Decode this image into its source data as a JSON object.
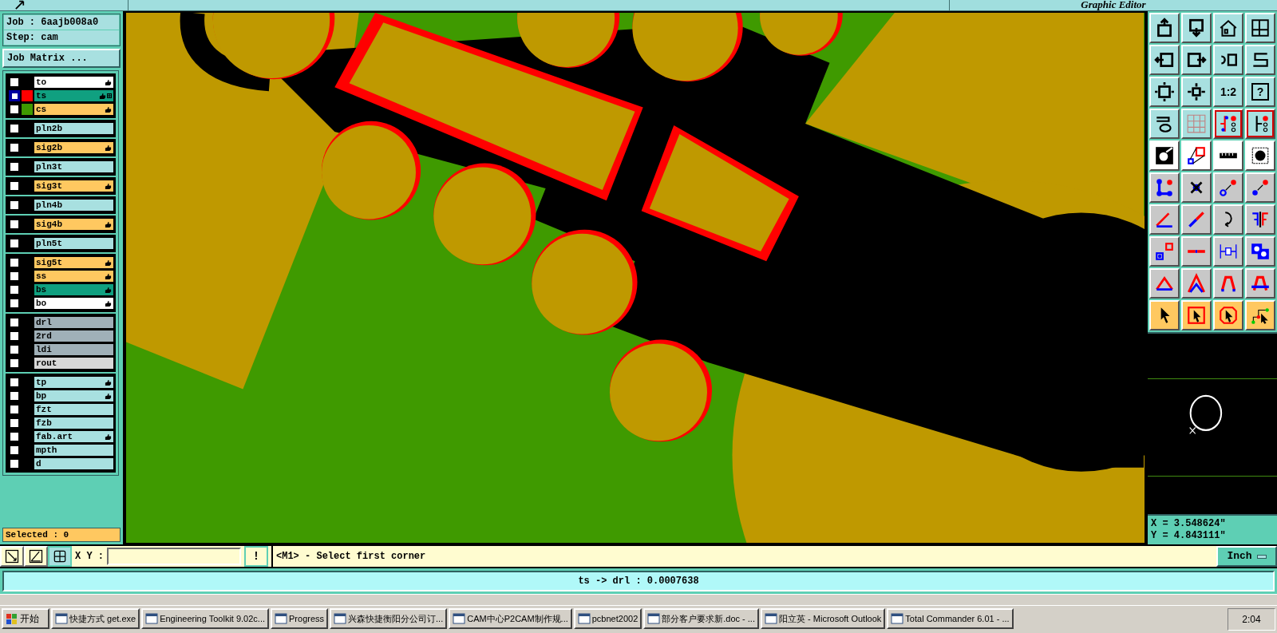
{
  "top_bar": {
    "title": "Graphic Editor"
  },
  "job": {
    "job": "Job : 6aajb008a0",
    "step": "Step: cam",
    "matrix_button": "Job Matrix ..."
  },
  "layer_groups": [
    {
      "layers": [
        {
          "name": "to",
          "kind": "board",
          "selected": false,
          "hand": true,
          "grid_mark": false
        },
        {
          "name": "ts",
          "kind": "mask",
          "color": "#ff0000",
          "selected": true,
          "hand": true,
          "grid_mark": true
        },
        {
          "name": "cs",
          "kind": "signal",
          "color": "#3f9a00",
          "selected": false,
          "hand": true,
          "grid_mark": false
        }
      ]
    },
    {
      "layers": [
        {
          "name": "pln2b",
          "kind": "plane",
          "selected": false,
          "hand": false,
          "grid_mark": false
        }
      ]
    },
    {
      "layers": [
        {
          "name": "sig2b",
          "kind": "signal",
          "selected": false,
          "hand": true,
          "grid_mark": false
        }
      ]
    },
    {
      "layers": [
        {
          "name": "pln3t",
          "kind": "plane",
          "selected": false,
          "hand": false,
          "grid_mark": false
        }
      ]
    },
    {
      "layers": [
        {
          "name": "sig3t",
          "kind": "signal",
          "selected": false,
          "hand": true,
          "grid_mark": false
        }
      ]
    },
    {
      "layers": [
        {
          "name": "pln4b",
          "kind": "plane",
          "selected": false,
          "hand": false,
          "grid_mark": false
        }
      ]
    },
    {
      "layers": [
        {
          "name": "sig4b",
          "kind": "signal",
          "selected": false,
          "hand": true,
          "grid_mark": false
        }
      ]
    },
    {
      "layers": [
        {
          "name": "pln5t",
          "kind": "plane",
          "selected": false,
          "hand": false,
          "grid_mark": false
        }
      ]
    },
    {
      "layers": [
        {
          "name": "sig5t",
          "kind": "signal",
          "selected": false,
          "hand": true,
          "grid_mark": false
        },
        {
          "name": "ss",
          "kind": "signal",
          "selected": false,
          "hand": true,
          "grid_mark": false
        },
        {
          "name": "bs",
          "kind": "mask",
          "selected": false,
          "hand": true,
          "grid_mark": false
        },
        {
          "name": "bo",
          "kind": "board",
          "selected": false,
          "hand": true,
          "grid_mark": false
        }
      ]
    },
    {
      "layers": [
        {
          "name": "drl",
          "kind": "drill",
          "selected": false,
          "hand": false,
          "grid_mark": false
        },
        {
          "name": "2rd",
          "kind": "drill",
          "selected": false,
          "hand": false,
          "grid_mark": false
        },
        {
          "name": "ldi",
          "kind": "drill",
          "selected": false,
          "hand": false,
          "grid_mark": false
        },
        {
          "name": "rout",
          "kind": "rout",
          "selected": false,
          "hand": false,
          "grid_mark": false
        }
      ]
    },
    {
      "layers": [
        {
          "name": "tp",
          "kind": "plane",
          "selected": false,
          "hand": true,
          "grid_mark": false
        },
        {
          "name": "bp",
          "kind": "plane",
          "selected": false,
          "hand": true,
          "grid_mark": false
        },
        {
          "name": "fzt",
          "kind": "plane",
          "selected": false,
          "hand": false,
          "grid_mark": false
        },
        {
          "name": "fzb",
          "kind": "plane",
          "selected": false,
          "hand": false,
          "grid_mark": false
        },
        {
          "name": "fab.art",
          "kind": "plane",
          "selected": false,
          "hand": true,
          "grid_mark": false
        },
        {
          "name": "mpth",
          "kind": "plane",
          "selected": false,
          "hand": false,
          "grid_mark": false
        },
        {
          "name": "d",
          "kind": "plane",
          "selected": false,
          "hand": false,
          "grid_mark": false
        }
      ]
    }
  ],
  "selected_count": "Selected : 0",
  "toolbar": {
    "scale_label": "1:2",
    "help_label": "?"
  },
  "coordinates": {
    "x": "X = 3.548624\"",
    "y": "Y = 4.843111\""
  },
  "command_bar": {
    "xy_label": "X Y :",
    "exclaim": "!",
    "prompt": "<M1> - Select first corner",
    "unit": "Inch"
  },
  "status": "ts -> drl : 0.0007638",
  "taskbar": {
    "start": "开始",
    "tasks": [
      {
        "label": "快捷方式 get.exe"
      },
      {
        "label": "Engineering Toolkit 9.02c..."
      },
      {
        "label": "Progress"
      },
      {
        "label": "兴森快捷衡阳分公司订..."
      },
      {
        "label": "CAM中心P2CAM制作规..."
      },
      {
        "label": "pcbnet2002"
      },
      {
        "label": "部分客户要求新.doc - ..."
      },
      {
        "label": "阳立英 - Microsoft Outlook"
      },
      {
        "label": "Total Commander 6.01 - ..."
      }
    ],
    "clock": "2:04"
  }
}
